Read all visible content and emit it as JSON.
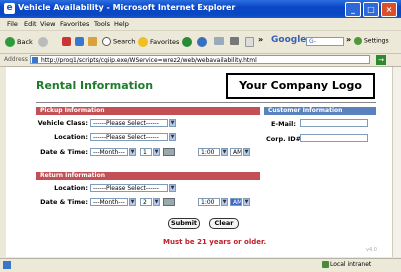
{
  "window": {
    "title": "Vehicle Availability - Microsoft Internet Explorer",
    "minimize": "_",
    "maximize": "□",
    "close": "×"
  },
  "menu": [
    "File",
    "Edit",
    "View",
    "Favorites",
    "Tools",
    "Help"
  ],
  "toolbar": {
    "back": "Back",
    "search": "Search",
    "favorites": "Favorites",
    "overflow": "»",
    "google": "Google",
    "google_box": "G-",
    "settings": "Settings"
  },
  "address": {
    "label": "Address",
    "url": "http://prog1/scripts/cgiip.exe/WService=wrez2/web/webavailability.html",
    "go": "→"
  },
  "page": {
    "heading": "Rental Information",
    "logo": "Your Company Logo",
    "pickup": {
      "title": "Pickup Information",
      "vehicle_label": "Vehicle Class:",
      "vehicle_value": "------Please Select------",
      "location_label": "Location:",
      "location_value": "------Please Select------",
      "datetime_label": "Date & Time:",
      "month_value": "---Month---",
      "day_value": "1",
      "time_value": "1:00",
      "ampm_value": "AM"
    },
    "customer": {
      "title": "Customer Information",
      "email_label": "E-Mail:",
      "email_value": "",
      "corp_label": "Corp. ID#:",
      "corp_value": ""
    },
    "return": {
      "title": "Return Information",
      "location_label": "Location:",
      "location_value": "------Please Select------",
      "datetime_label": "Date & Time:",
      "month_value": "---Month---",
      "day_value": "2",
      "time_value": "1:00",
      "ampm_value": "AM"
    },
    "submit": "Submit",
    "clear": "Clear",
    "note": "Must be 21 years or older.",
    "version": "v4.0"
  },
  "status": {
    "zone": "Local intranet"
  },
  "colors": {
    "heading": "#1f7a2c",
    "pickup_bar": "#c25055",
    "customer_bar": "#5a83be",
    "note": "#c0202a"
  }
}
